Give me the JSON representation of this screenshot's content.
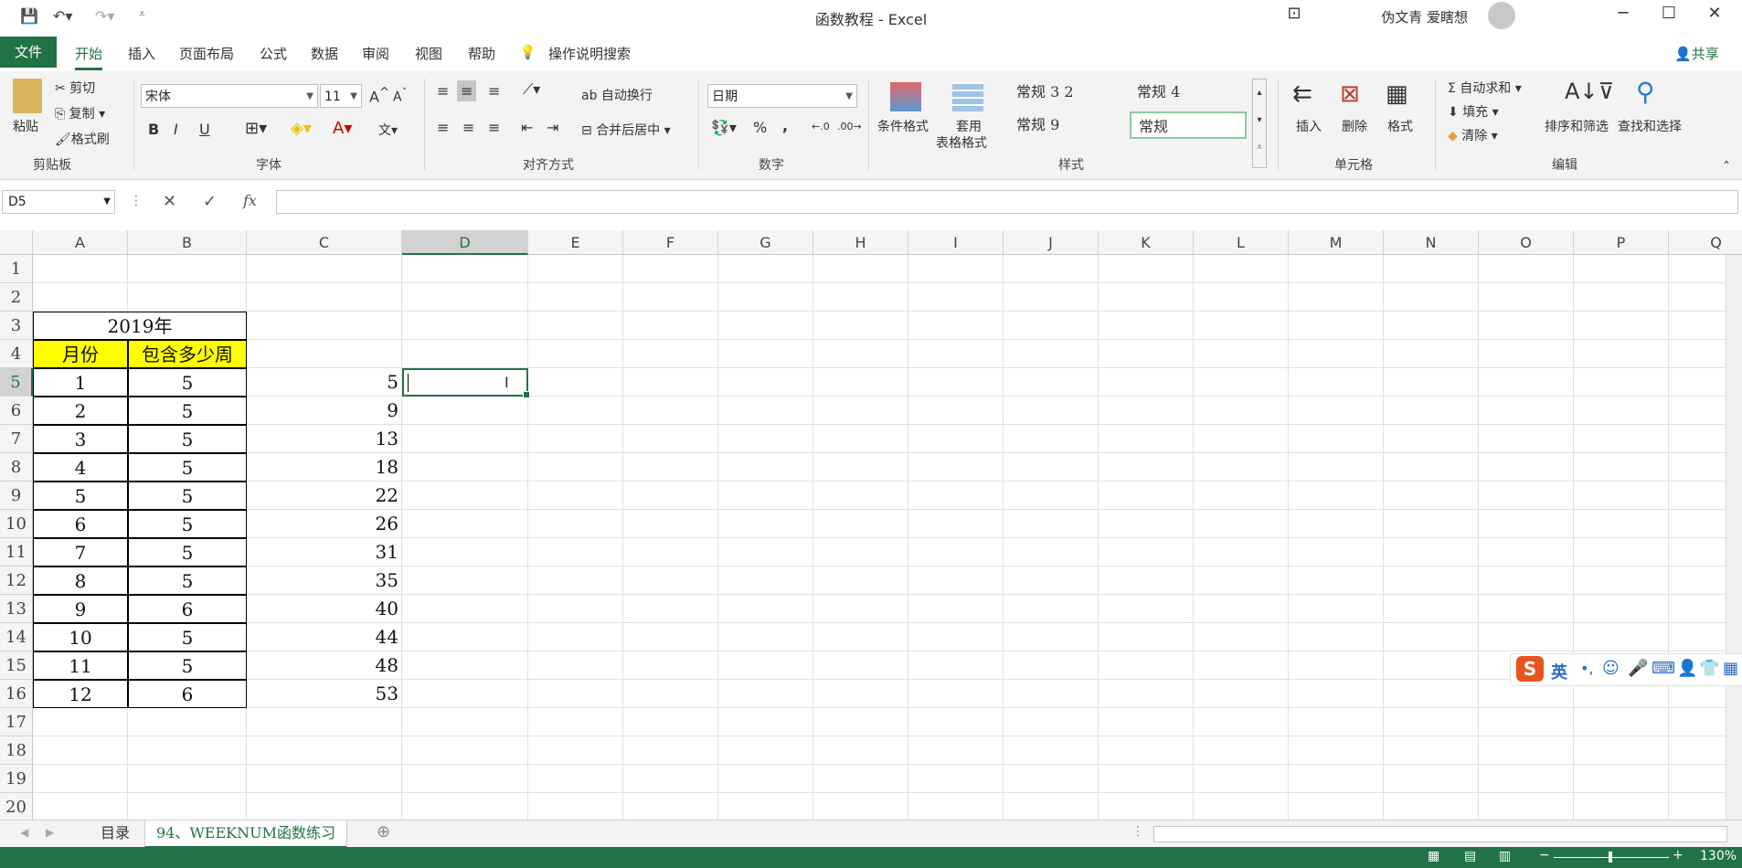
{
  "app": {
    "doc_title": "函数教程  -  Excel",
    "user_name": "伪文青 爱瞎想"
  },
  "tabs": [
    "文件",
    "开始",
    "插入",
    "页面布局",
    "公式",
    "数据",
    "审阅",
    "视图",
    "帮助"
  ],
  "tell_me": "操作说明搜索",
  "share": "共享",
  "ribbon": {
    "clipboard": {
      "paste": "粘贴",
      "cut": "剪切",
      "copy": "复制",
      "format_painter": "格式刷",
      "group": "剪贴板"
    },
    "font": {
      "name": "宋体",
      "size": "11",
      "bold": "B",
      "italic": "I",
      "underline": "U",
      "group": "字体"
    },
    "alignment": {
      "wrap": "自动换行",
      "merge": "合并后居中",
      "group": "对齐方式"
    },
    "number": {
      "format": "日期",
      "percent": "%",
      "comma": ",",
      "group": "数字"
    },
    "styles": {
      "conditional": "条件格式",
      "table_format_1": "套用",
      "table_format_2": "表格格式",
      "cells": [
        "常规 3 2",
        "常规 4",
        "常规 9",
        "常规"
      ],
      "group": "样式"
    },
    "cells": {
      "insert": "插入",
      "delete": "删除",
      "format": "格式",
      "group": "单元格"
    },
    "editing": {
      "autosum": "自动求和",
      "fill": "填充",
      "clear": "清除",
      "sort": "排序和筛选",
      "find": "查找和选择",
      "group": "编辑"
    }
  },
  "formula_bar": {
    "name_box": "D5",
    "fx": "fx",
    "value": ""
  },
  "columns": [
    "A",
    "B",
    "C",
    "D",
    "E",
    "F",
    "G",
    "H",
    "I",
    "J",
    "K",
    "L",
    "M",
    "N",
    "O",
    "P",
    "Q"
  ],
  "rows": [
    "1",
    "2",
    "3",
    "4",
    "5",
    "6",
    "7",
    "8",
    "9",
    "10",
    "11",
    "12",
    "13",
    "14",
    "15",
    "16",
    "17",
    "18",
    "19",
    "20"
  ],
  "table": {
    "year": "2019年",
    "header_month": "月份",
    "header_weeks": "包含多少周",
    "data": [
      {
        "month": "1",
        "weeks": "5",
        "c": "5"
      },
      {
        "month": "2",
        "weeks": "5",
        "c": "9"
      },
      {
        "month": "3",
        "weeks": "5",
        "c": "13"
      },
      {
        "month": "4",
        "weeks": "5",
        "c": "18"
      },
      {
        "month": "5",
        "weeks": "5",
        "c": "22"
      },
      {
        "month": "6",
        "weeks": "5",
        "c": "26"
      },
      {
        "month": "7",
        "weeks": "5",
        "c": "31"
      },
      {
        "month": "8",
        "weeks": "5",
        "c": "35"
      },
      {
        "month": "9",
        "weeks": "6",
        "c": "40"
      },
      {
        "month": "10",
        "weeks": "5",
        "c": "44"
      },
      {
        "month": "11",
        "weeks": "5",
        "c": "48"
      },
      {
        "month": "12",
        "weeks": "6",
        "c": "53"
      }
    ]
  },
  "sheets": [
    "目录",
    "94、WEEKNUM函数练习"
  ],
  "status": {
    "zoom": "130%"
  },
  "ime": {
    "lang": "英"
  },
  "colors": {
    "excel_green": "#217346",
    "header_yellow": "#ffff00",
    "selection_green": "#217346"
  }
}
